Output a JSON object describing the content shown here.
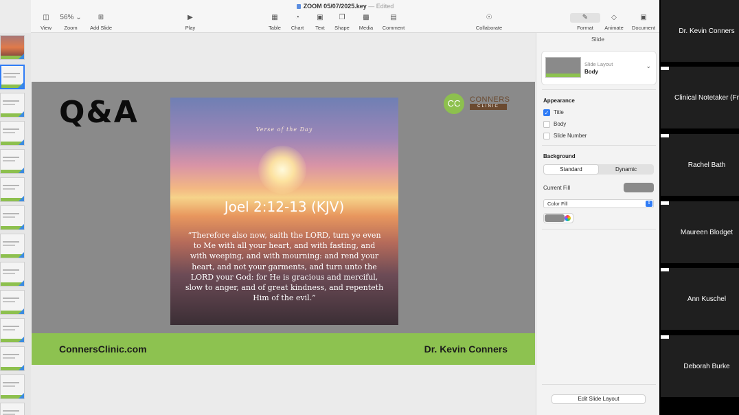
{
  "window": {
    "document_title": "ZOOM 05/07/2025.key",
    "separator": "—",
    "status": "Edited"
  },
  "toolbar": {
    "view": {
      "label": "View",
      "icon": "sidebar-icon"
    },
    "zoom": {
      "label": "Zoom",
      "value": "56%"
    },
    "add_slide": {
      "label": "Add Slide",
      "icon": "plus-icon"
    },
    "play": {
      "label": "Play",
      "icon": "play-icon"
    },
    "table": {
      "label": "Table",
      "icon": "table-icon"
    },
    "chart": {
      "label": "Chart",
      "icon": "chart-icon"
    },
    "text": {
      "label": "Text",
      "icon": "text-icon"
    },
    "shape": {
      "label": "Shape",
      "icon": "shape-icon"
    },
    "media": {
      "label": "Media",
      "icon": "media-icon"
    },
    "comment": {
      "label": "Comment",
      "icon": "comment-icon"
    },
    "collaborate": {
      "label": "Collaborate",
      "icon": "collaborate-icon"
    },
    "format": {
      "label": "Format",
      "icon": "paintbrush-icon"
    },
    "animate": {
      "label": "Animate",
      "icon": "animate-icon"
    },
    "document": {
      "label": "Document",
      "icon": "document-icon"
    }
  },
  "slide": {
    "heading": "Q&A",
    "verse_banner": "Verse of the Day",
    "verse_reference": "Joel 2:12-13 (KJV)",
    "verse_text": "“Therefore also now, saith the LORD, turn ye even to Me with all your heart, and with fasting, and with weeping, and with mourning: and rend your heart, and not your garments, and turn unto the LORD your God: for He is gracious and merciful, slow to anger, and of great kindness, and repenteth Him of the evil.”",
    "logo_mark": "CC",
    "logo_name": "CONNERS",
    "logo_sub": "CLINIC",
    "footer_left": "ConnersClinic.com",
    "footer_right": "Dr. Kevin Conners",
    "colors": {
      "background": "#8a8a8a",
      "band": "#8dc250",
      "logo_green": "#8dc04e",
      "logo_brown": "#6b4a30"
    }
  },
  "inspector": {
    "tab": "Slide",
    "layout_label": "Slide Layout",
    "layout_value": "Body",
    "appearance": {
      "heading": "Appearance",
      "title": {
        "label": "Title",
        "checked": true
      },
      "body": {
        "label": "Body",
        "checked": false
      },
      "slide_number": {
        "label": "Slide Number",
        "checked": false
      }
    },
    "background": {
      "heading": "Background",
      "standard": "Standard",
      "dynamic": "Dynamic",
      "current_fill_label": "Current Fill",
      "fill_type": "Color Fill"
    },
    "edit_layout": "Edit Slide Layout"
  },
  "participants": [
    "Dr. Kevin Conners",
    "Clinical Notetaker (Fr",
    "Rachel Bath",
    "Maureen Blodget",
    "Ann Kuschel",
    "Deborah Burke"
  ]
}
